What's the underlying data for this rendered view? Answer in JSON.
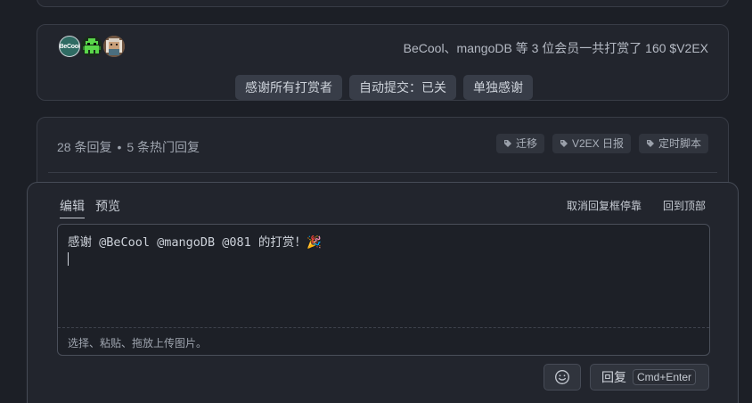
{
  "tip": {
    "summary": "BeCool、mangoDB 等 3 位会员一共打赏了 160 $V2EX",
    "avatars": [
      {
        "label": "BeCool",
        "icon": "becool-avatar"
      },
      {
        "label": "",
        "icon": "pixel-invader-avatar"
      },
      {
        "label": "",
        "icon": "pixel-portrait-avatar"
      }
    ],
    "actions": {
      "thank_all": "感谢所有打赏者",
      "auto_submit": "自动提交：已关",
      "thank_individual": "单独感谢"
    }
  },
  "replies": {
    "count": "28 条回复",
    "separator": "•",
    "hot": "5 条热门回复",
    "tags": [
      "迁移",
      "V2EX 日报",
      "定时脚本"
    ]
  },
  "editor": {
    "tabs": {
      "edit": "编辑",
      "preview": "预览"
    },
    "links": {
      "undock": "取消回复框停靠",
      "back_to_top": "回到顶部"
    },
    "content": "感谢 @BeCool @mangoDB @081 的打赏！",
    "emoji": "🎉",
    "upload_hint": "选择、粘贴、拖放上传图片。",
    "submit_label": "回复",
    "shortcut": "Cmd+Enter"
  }
}
